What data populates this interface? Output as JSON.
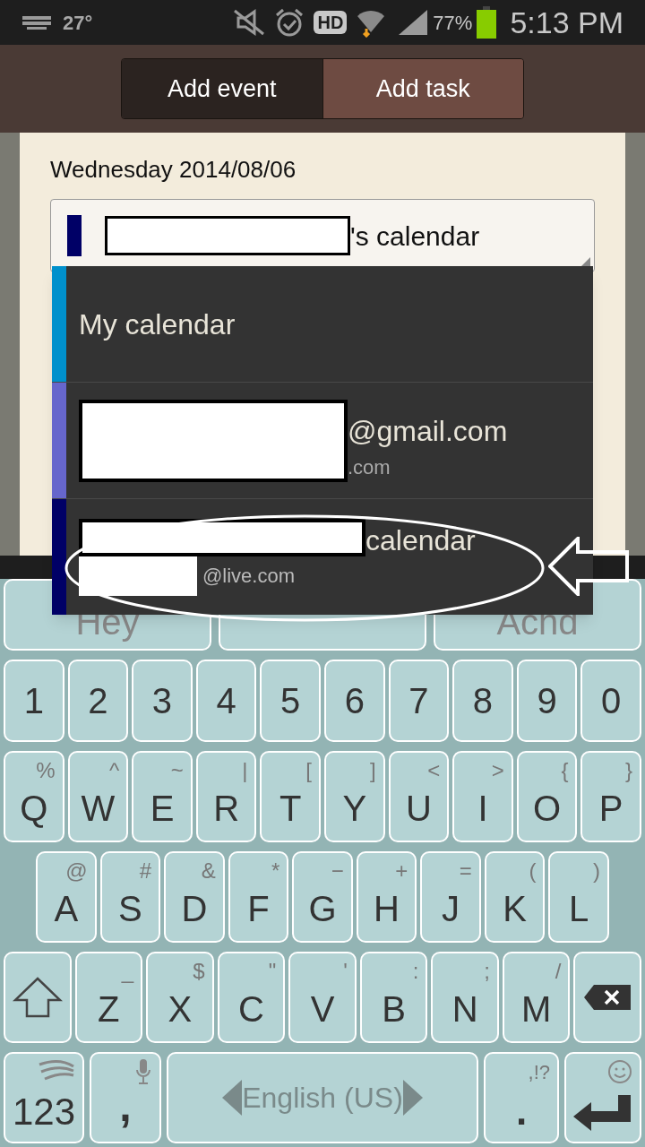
{
  "status_bar": {
    "temperature": "27°",
    "hd": "HD",
    "battery": "77%",
    "time": "5:13 PM"
  },
  "tabs": [
    {
      "label": "Add event",
      "selected": true
    },
    {
      "label": "Add task",
      "selected": false
    }
  ],
  "date": "Wednesday 2014/08/06",
  "calendar_field": {
    "color": "#000066",
    "redacted": true,
    "value": "'s calendar"
  },
  "calendars": [
    {
      "name": "My calendar",
      "color": "#0090cc",
      "redacted": false,
      "highlighted": false
    },
    {
      "name": "@gmail.com",
      "account": ".com",
      "color": "#6666cc",
      "redacted": true,
      "highlighted": false
    },
    {
      "name": "calendar",
      "account": "@live.com",
      "color": "#000066",
      "redacted": true,
      "highlighted": true
    }
  ],
  "suggestions": [
    "Hey",
    "Achd"
  ],
  "keyboard": {
    "number_row": [
      "1",
      "2",
      "3",
      "4",
      "5",
      "6",
      "7",
      "8",
      "9",
      "0"
    ],
    "rows": [
      [
        {
          "key": "Q",
          "alt": "%"
        },
        {
          "key": "W",
          "alt": "^"
        },
        {
          "key": "E",
          "alt": "~"
        },
        {
          "key": "R",
          "alt": "|"
        },
        {
          "key": "T",
          "alt": "["
        },
        {
          "key": "Y",
          "alt": "]"
        },
        {
          "key": "U",
          "alt": "<"
        },
        {
          "key": "I",
          "alt": ">"
        },
        {
          "key": "O",
          "alt": "{"
        },
        {
          "key": "P",
          "alt": "}"
        }
      ],
      [
        {
          "key": "A",
          "alt": "@"
        },
        {
          "key": "S",
          "alt": "#"
        },
        {
          "key": "D",
          "alt": "&"
        },
        {
          "key": "F",
          "alt": "*"
        },
        {
          "key": "G",
          "alt": "−"
        },
        {
          "key": "H",
          "alt": "+"
        },
        {
          "key": "J",
          "alt": "="
        },
        {
          "key": "K",
          "alt": "("
        },
        {
          "key": "L",
          "alt": ")"
        }
      ],
      [
        {
          "key": "Z",
          "alt": "_"
        },
        {
          "key": "X",
          "alt": "$"
        },
        {
          "key": "C",
          "alt": "\""
        },
        {
          "key": "V",
          "alt": "'"
        },
        {
          "key": "B",
          "alt": ":"
        },
        {
          "key": "N",
          "alt": ";"
        },
        {
          "key": "M",
          "alt": "/"
        }
      ]
    ],
    "symbols": "123",
    "comma": ",",
    "space": "English (US)",
    "period": ".",
    "period_alt": ",!?"
  }
}
